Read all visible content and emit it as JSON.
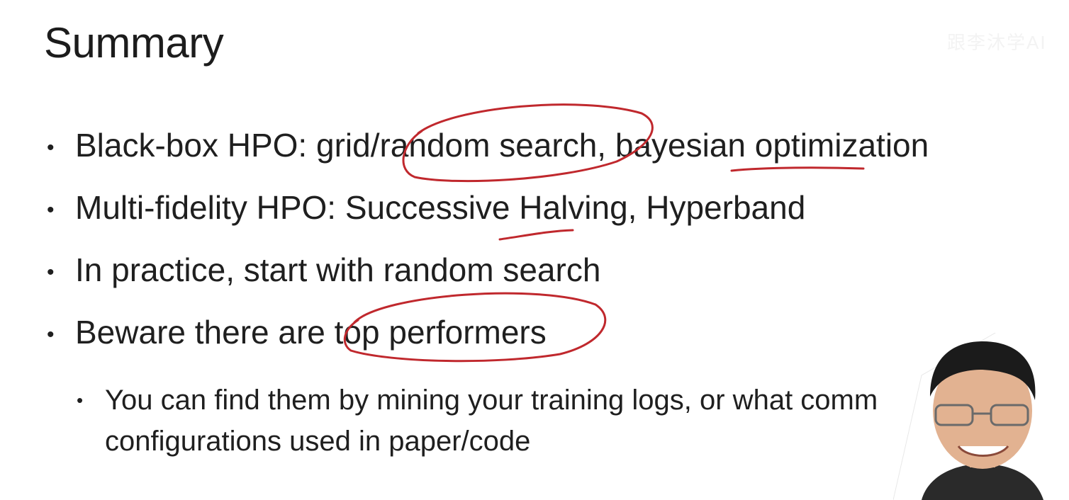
{
  "slide": {
    "title": "Summary",
    "watermark": "跟李沐学AI"
  },
  "bullets": [
    {
      "text": "Black-box HPO: grid/random search, bayesian optimization"
    },
    {
      "text": "Multi-fidelity HPO: Successive Halving, Hyperband"
    },
    {
      "text": "In practice, start with random search"
    },
    {
      "text": "Beware there are top performers"
    }
  ],
  "sub_bullet": {
    "line1": "You can find them by mining your training logs, or what comm",
    "line2": "configurations used in paper/code"
  },
  "bullet_glyph": "•",
  "colors": {
    "ink": "#c0282d",
    "text": "#1f1f1f",
    "background": "#ffffff"
  }
}
